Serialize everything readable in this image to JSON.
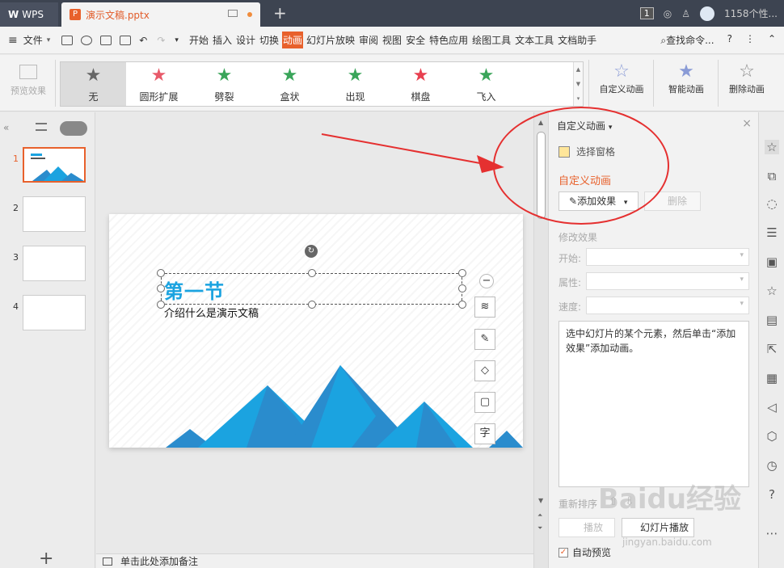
{
  "titlebar": {
    "app_name": "WPS",
    "doc_tab": "演示文稿.pptx",
    "page_badge": "1",
    "user_name": "1158个性..."
  },
  "menubar": {
    "file": "文件",
    "items": [
      "开始",
      "插入",
      "设计",
      "切换",
      "动画",
      "幻灯片放映",
      "审阅",
      "视图",
      "安全",
      "特色应用",
      "绘图工具",
      "文本工具",
      "文档助手"
    ],
    "active_item": "动画",
    "search": "查找命令...",
    "help": "?"
  },
  "ribbon": {
    "preview": "预览效果",
    "gallery": [
      {
        "label": "无",
        "color": "#666666"
      },
      {
        "label": "圆形扩展",
        "color": "#e85a6a"
      },
      {
        "label": "劈裂",
        "color": "#3aa55a"
      },
      {
        "label": "盒状",
        "color": "#3aa55a"
      },
      {
        "label": "出现",
        "color": "#3aa55a"
      },
      {
        "label": "棋盘",
        "color": "#e84050"
      },
      {
        "label": "飞入",
        "color": "#3aa55a"
      }
    ],
    "custom_anim": "自定义动画",
    "smart_anim": "智能动画",
    "delete_anim": "删除动画"
  },
  "slides": [
    {
      "num": "1"
    },
    {
      "num": "2"
    },
    {
      "num": "3"
    },
    {
      "num": "4"
    }
  ],
  "slide": {
    "title": "第一节",
    "subtitle": "介绍什么是演示文稿"
  },
  "notes": "单击此处添加备注",
  "taskpane": {
    "header": "自定义动画",
    "select_pane": "选择窗格",
    "section_title": "自定义动画",
    "add_effect": "添加效果",
    "delete": "删除",
    "modify_title": "修改效果",
    "start_label": "开始:",
    "property_label": "属性:",
    "speed_label": "速度:",
    "hint": "选中幻灯片的某个元素，然后单击“添加效果”添加动画。",
    "reorder": "重新排序",
    "play": "播放",
    "slideshow": "幻灯片播放",
    "auto_preview": "自动预览"
  },
  "watermark": {
    "brand": "Baidu经验",
    "url": "jingyan.baidu.com"
  },
  "colors": {
    "accent": "#e8612c",
    "annotation": "#e53030",
    "slide_title": "#1ba3e0"
  }
}
